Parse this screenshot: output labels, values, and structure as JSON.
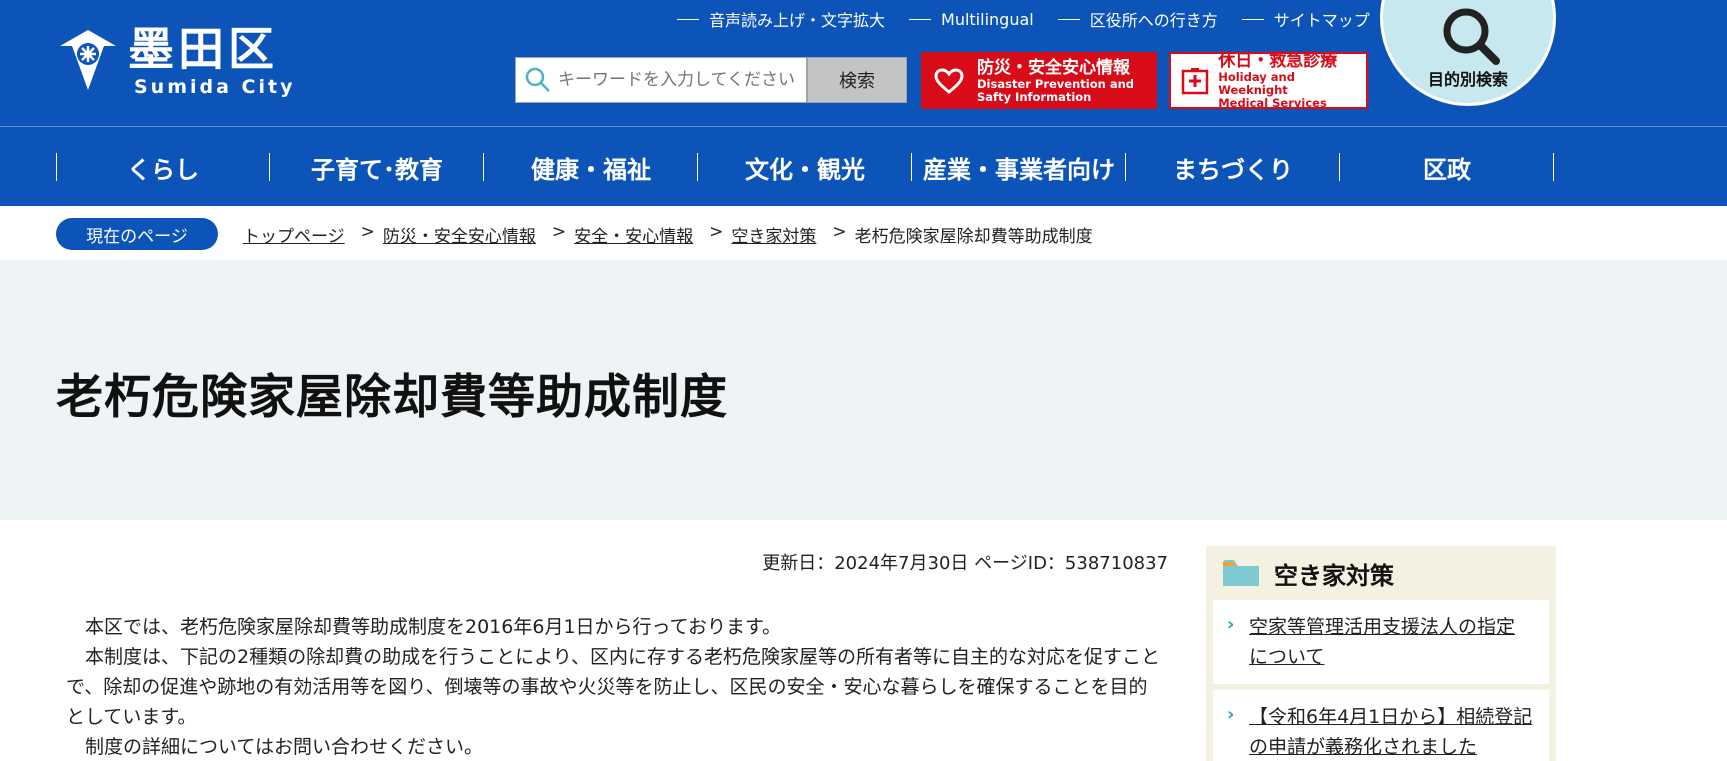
{
  "logo": {
    "ja": "墨田区",
    "en": "Sumida City"
  },
  "util_nav": [
    {
      "label": "音声読み上げ・文字拡大"
    },
    {
      "label": "Multilingual"
    },
    {
      "label": "区役所への行き方"
    },
    {
      "label": "サイトマップ"
    }
  ],
  "search": {
    "placeholder": "キーワードを入力してください",
    "button_label": "検索"
  },
  "banners": {
    "disaster": {
      "title": "防災・安全安心情報",
      "sub1": "Disaster Prevention and",
      "sub2": "Safty Information",
      "color": "#d80c18"
    },
    "holiday": {
      "title": "休日・救急診療",
      "sub1": "Holiday and Weeknight",
      "sub2": "Medical Services",
      "color": "#d80c18"
    }
  },
  "purpose_search": {
    "label": "目的別検索"
  },
  "global_nav": [
    {
      "label": "くらし"
    },
    {
      "label": "子育て･教育"
    },
    {
      "label": "健康・福祉"
    },
    {
      "label": "文化・観光"
    },
    {
      "label": "産業・事業者向け"
    },
    {
      "label": "まちづくり"
    },
    {
      "label": "区政"
    }
  ],
  "breadcrumb": {
    "badge": "現在のページ",
    "links": [
      "トップページ",
      "防災・安全安心情報",
      "安全・安心情報",
      "空き家対策"
    ],
    "sep": ">",
    "current": "老朽危険家屋除却費等助成制度"
  },
  "page": {
    "title": "老朽危険家屋除却費等助成制度",
    "meta": "更新日：2024年7月30日 ページID：538710837",
    "paragraphs": [
      "本区では、老朽危険家屋除却費等助成制度を2016年6月1日から行っております。",
      "本制度は、下記の2種類の除却費の助成を行うことにより、区内に存する老朽危険家屋等の所有者等に自主的な対応を促すことで、除却の促進や跡地の有効活用等を図り、倒壊等の事故や火災等を防止し、区民の安全・安心な暮らしを確保することを目的としています。",
      "制度の詳細についてはお問い合わせください。"
    ]
  },
  "side_menu": {
    "title": "空き家対策",
    "items": [
      {
        "label": "空家等管理活用支援法人の指定について"
      },
      {
        "label": "【令和6年4月1日から】相続登記の申請が義務化されました"
      }
    ]
  },
  "colors": {
    "brand_blue": "#0c54b8",
    "title_band": "#eef4f6",
    "side_bg": "#f4f1e2",
    "accent_teal": "#2aa1b3"
  }
}
